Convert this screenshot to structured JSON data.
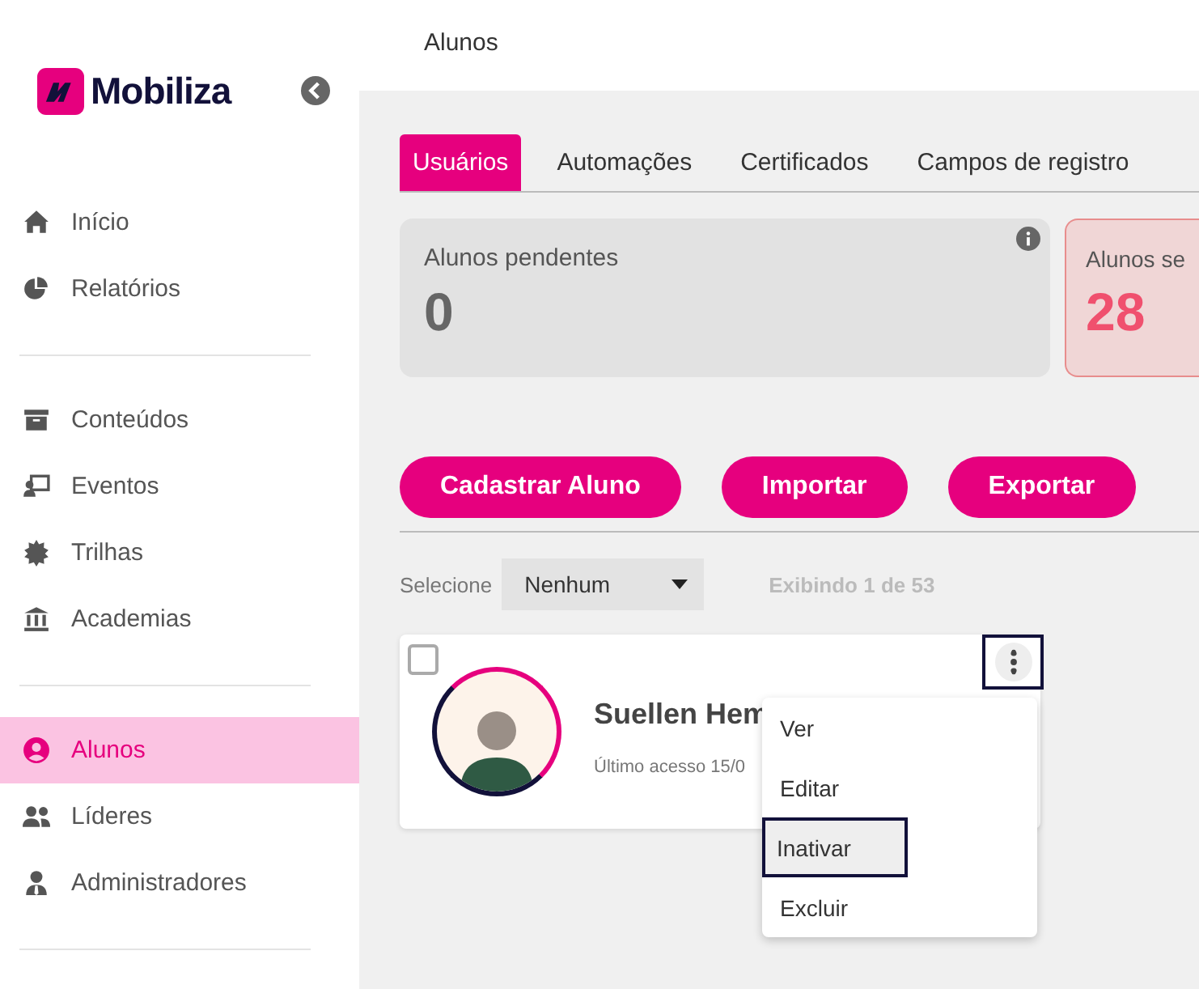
{
  "sidebar": {
    "logo": "Mobiliza",
    "groups": [
      [
        {
          "label": "Início",
          "selected": false
        },
        {
          "label": "Relatórios",
          "selected": false
        }
      ],
      [
        {
          "label": "Conteúdos",
          "selected": false
        },
        {
          "label": "Eventos",
          "selected": false
        },
        {
          "label": "Trilhas",
          "selected": false
        },
        {
          "label": "Academias",
          "selected": false
        }
      ],
      [
        {
          "label": "Alunos",
          "selected": true
        },
        {
          "label": "Líderes",
          "selected": false
        },
        {
          "label": "Administradores",
          "selected": false
        }
      ]
    ]
  },
  "header": {
    "title": "Alunos"
  },
  "tabs": [
    {
      "label": "Usuários",
      "selected": true
    },
    {
      "label": "Automações",
      "selected": false
    },
    {
      "label": "Certificados",
      "selected": false
    },
    {
      "label": "Campos de registro",
      "selected": false
    }
  ],
  "stats": [
    {
      "label": "Alunos pendentes",
      "value": "0",
      "kind": "neutral"
    },
    {
      "label": "Alunos se",
      "value": "28",
      "kind": "alert"
    }
  ],
  "actions": [
    "Cadastrar Aluno",
    "Importar",
    "Exportar"
  ],
  "filter": {
    "label": "Selecione",
    "value": "Nenhum",
    "count": "Exibindo 1 de 53"
  },
  "students": [
    {
      "name": "Suellen Hem",
      "last_access": "Último acesso 15/0",
      "checked": false
    }
  ],
  "menu": [
    {
      "label": "Ver",
      "selected": false
    },
    {
      "label": "Editar",
      "selected": false
    },
    {
      "label": "Inativar",
      "selected": true
    },
    {
      "label": "Excluir",
      "selected": false
    }
  ]
}
